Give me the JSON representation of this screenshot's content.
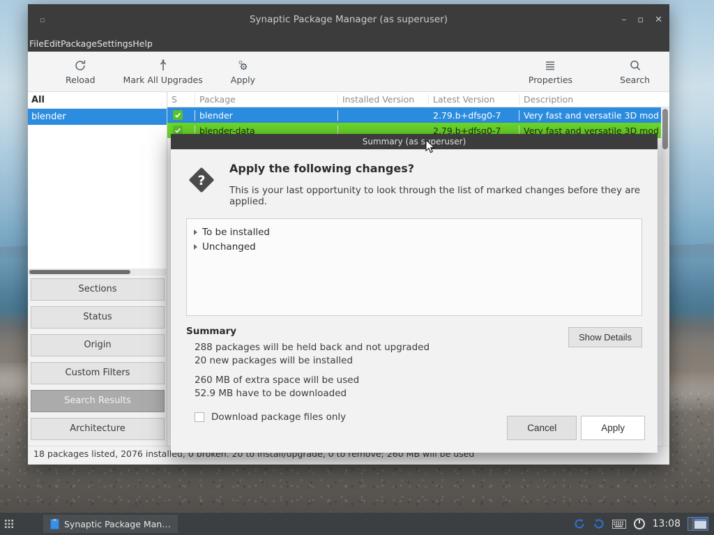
{
  "window": {
    "title": "Synaptic Package Manager  (as superuser)",
    "menu": [
      "File",
      "Edit",
      "Package",
      "Settings",
      "Help"
    ],
    "controls": {
      "minimize": "–",
      "maximize": "▫",
      "close": "✕",
      "icon": "▫"
    }
  },
  "toolbar": {
    "left": [
      {
        "label": "Reload",
        "icon": "reload-icon"
      },
      {
        "label": "Mark All Upgrades",
        "icon": "upgrade-arrow-icon"
      },
      {
        "label": "Apply",
        "icon": "apply-gear-icon"
      }
    ],
    "right": [
      {
        "label": "Properties",
        "icon": "properties-lines-icon"
      },
      {
        "label": "Search",
        "icon": "search-icon"
      }
    ]
  },
  "sidebar": {
    "filter_header": "All",
    "filter_items": [
      {
        "label": "blender",
        "selected": true
      }
    ],
    "buttons": [
      {
        "label": "Sections",
        "active": false
      },
      {
        "label": "Status",
        "active": false
      },
      {
        "label": "Origin",
        "active": false
      },
      {
        "label": "Custom Filters",
        "active": false
      },
      {
        "label": "Search Results",
        "active": true
      },
      {
        "label": "Architecture",
        "active": false
      }
    ]
  },
  "package_list": {
    "columns": [
      "S",
      "Package",
      "Installed Version",
      "Latest Version",
      "Description"
    ],
    "rows": [
      {
        "checked": true,
        "package": "blender",
        "installed_version": "",
        "latest_version": "2.79.b+dfsg0-7",
        "description": "Very fast and versatile 3D mod",
        "state": "selected"
      },
      {
        "checked": true,
        "package": "blender-data",
        "installed_version": "",
        "latest_version": "2.79.b+dfsg0-7",
        "description": "Very fast and versatile 3D mod",
        "state": "marked"
      }
    ]
  },
  "statusbar": {
    "text": "18 packages listed, 2076 installed, 0 broken. 20 to install/upgrade, 0 to remove; 260 MB will be used"
  },
  "dialog": {
    "title": "Summary (as superuser)",
    "icon": "question-diamond-icon",
    "heading": "Apply the following changes?",
    "subtitle": "This is your last opportunity to look through the list of marked changes before they are applied.",
    "tree": [
      {
        "label": "To be installed",
        "expanded": false
      },
      {
        "label": "Unchanged",
        "expanded": false
      }
    ],
    "summary_title": "Summary",
    "summary_lines": [
      "288 packages will be held back and not upgraded",
      "20 new packages will be installed"
    ],
    "summary_lines2": [
      "260 MB of extra space will be used",
      "52.9 MB have to be downloaded"
    ],
    "details_button": "Show Details",
    "checkbox": {
      "label": "Download package files only",
      "checked": false
    },
    "cancel_button": "Cancel",
    "apply_button": "Apply"
  },
  "taskbar": {
    "launcher_icon": "app-grid-icon",
    "task": {
      "label": "Synaptic Package Man…",
      "icon": "synaptic-icon"
    },
    "tray": [
      {
        "name": "update-refresh-icon"
      },
      {
        "name": "undo-refresh-icon"
      },
      {
        "name": "keyboard-icon"
      },
      {
        "name": "power-icon"
      }
    ],
    "clock": "13:08",
    "workspace_switcher": "workspace-switcher-icon"
  },
  "colors": {
    "selection_blue": "#2c8de0",
    "marked_green": "#6ddb2a",
    "titlebar_dark": "#3c3c3c",
    "check_green": "#5cc12a"
  }
}
